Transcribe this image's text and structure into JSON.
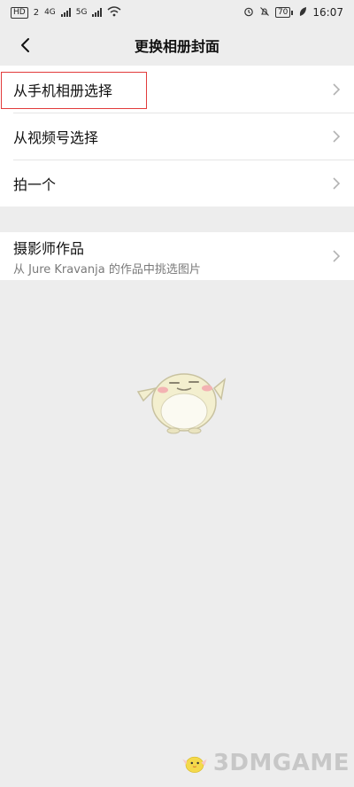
{
  "status": {
    "hd_label": "HD",
    "sim1": "2",
    "net1": "4G",
    "net2": "5G",
    "battery": "70",
    "time": "16:07"
  },
  "header": {
    "title": "更换相册封面"
  },
  "menu": [
    {
      "label": "从手机相册选择"
    },
    {
      "label": "从视频号选择"
    },
    {
      "label": "拍一个"
    }
  ],
  "photographer": {
    "title": "摄影师作品",
    "subtitle": "从 Jure Kravanja 的作品中挑选图片"
  },
  "watermark": {
    "text": "3DMGAME"
  }
}
